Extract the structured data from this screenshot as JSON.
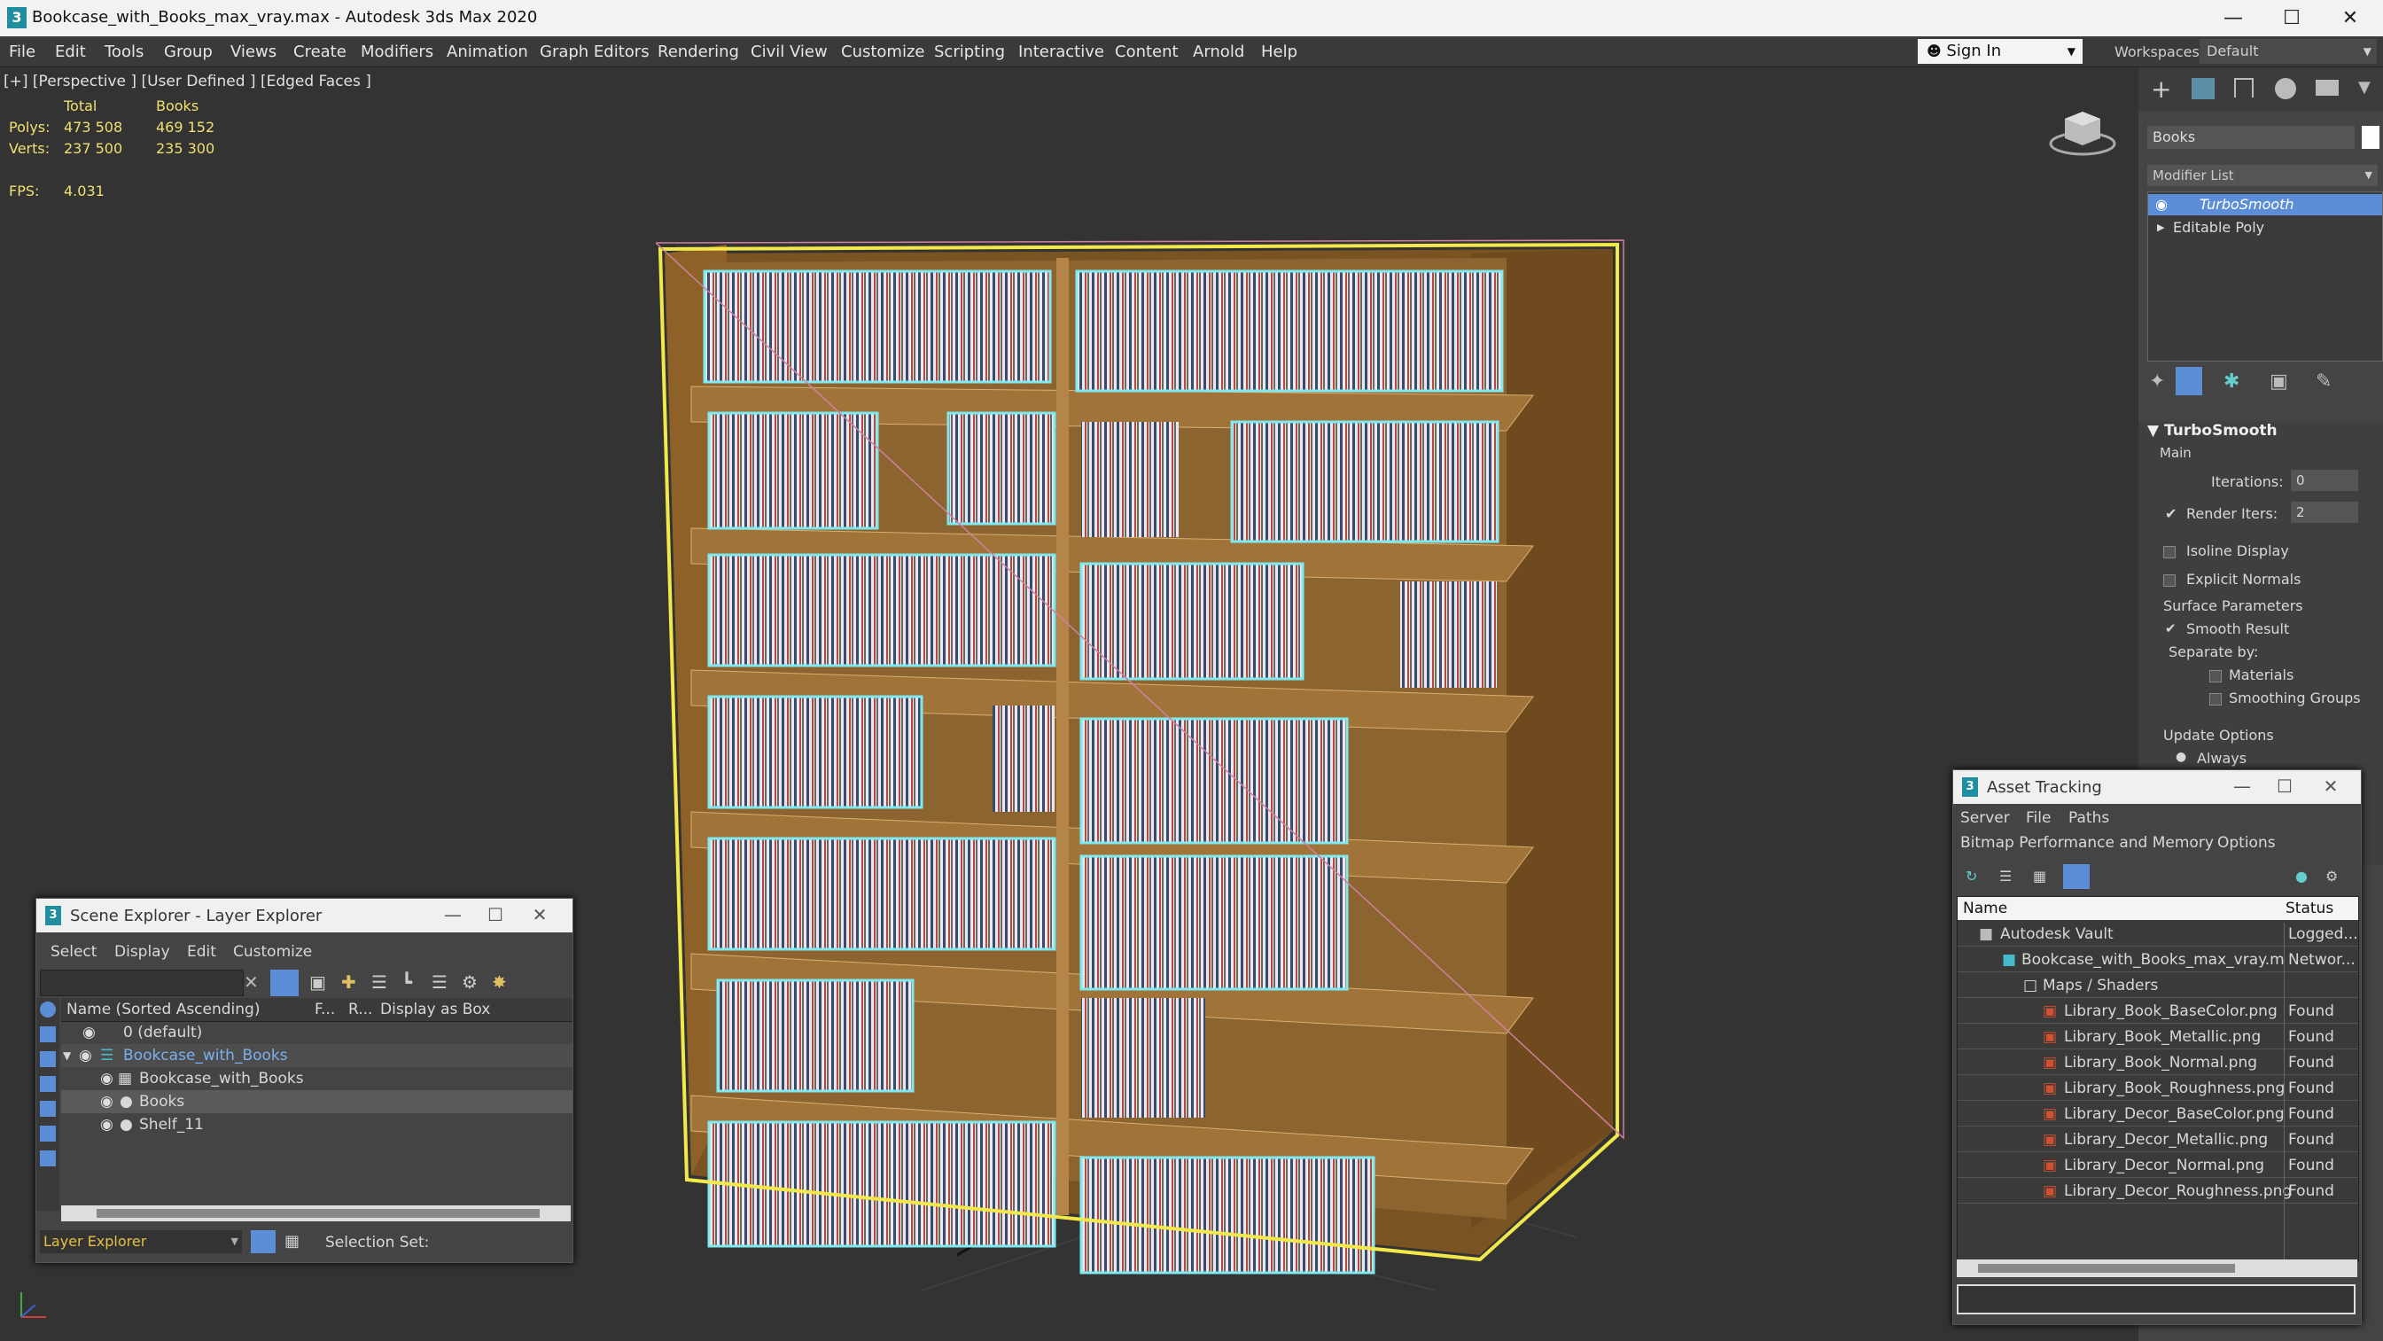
{
  "window": {
    "title": "Bookcase_with_Books_max_vray.max - Autodesk 3ds Max 2020",
    "app_icon": "3ds-max-icon"
  },
  "menu": [
    "File",
    "Edit",
    "Tools",
    "Group",
    "Views",
    "Create",
    "Modifiers",
    "Animation",
    "Graph Editors",
    "Rendering",
    "Civil View",
    "Customize",
    "Scripting",
    "Interactive",
    "Content",
    "Arnold",
    "Help"
  ],
  "signin": {
    "label": "Sign In"
  },
  "workspaces": {
    "label": "Workspaces:",
    "value": "Default"
  },
  "viewport": {
    "label": "[+] [Perspective ] [User Defined ] [Edged Faces ]",
    "stats": {
      "col_total": "Total",
      "col_books": "Books",
      "polys_label": "Polys:",
      "polys_total": "473 508",
      "polys_books": "469 152",
      "verts_label": "Verts:",
      "verts_total": "237 500",
      "verts_books": "235 300",
      "fps_label": "FPS:",
      "fps_value": "4.031"
    }
  },
  "command_panel": {
    "object_name": "Books",
    "object_color": "#ffffff",
    "modifier_list_label": "Modifier List",
    "stack": [
      "TurboSmooth",
      "Editable Poly"
    ],
    "rollout_title": "TurboSmooth",
    "main_label": "Main",
    "iterations_label": "Iterations:",
    "iterations_value": "0",
    "render_iters_label": "Render Iters:",
    "render_iters_value": "2",
    "isoline_label": "Isoline Display",
    "explicit_normals_label": "Explicit Normals",
    "surface_params_label": "Surface Parameters",
    "smooth_result_label": "Smooth Result",
    "separate_by_label": "Separate by:",
    "materials_label": "Materials",
    "smoothing_groups_label": "Smoothing Groups",
    "update_options_label": "Update Options",
    "always_label": "Always"
  },
  "scene_explorer": {
    "title": "Scene Explorer - Layer Explorer",
    "menu": [
      "Select",
      "Display",
      "Edit",
      "Customize"
    ],
    "columns": {
      "name": "Name (Sorted Ascending)",
      "f": "F...",
      "r": "R...",
      "display": "Display as Box"
    },
    "rows": [
      {
        "name": "0 (default)"
      },
      {
        "name": "Bookcase_with_Books"
      },
      {
        "name": "Bookcase_with_Books"
      },
      {
        "name": "Books"
      },
      {
        "name": "Shelf_11"
      }
    ],
    "footer_layer": "Layer Explorer",
    "footer_selset": "Selection Set:"
  },
  "asset_tracking": {
    "title": "Asset Tracking",
    "menu1": [
      "Server",
      "File",
      "Paths"
    ],
    "menu2": [
      "Bitmap Performance and Memory",
      "Options"
    ],
    "columns": {
      "name": "Name",
      "status": "Status"
    },
    "rows": [
      {
        "name": "Autodesk Vault",
        "status": "Logged...",
        "indent": 1
      },
      {
        "name": "Bookcase_with_Books_max_vray.max",
        "status": "Networ...",
        "indent": 2
      },
      {
        "name": "Maps / Shaders",
        "status": "",
        "indent": 3
      },
      {
        "name": "Library_Book_BaseColor.png",
        "status": "Found",
        "indent": 4
      },
      {
        "name": "Library_Book_Metallic.png",
        "status": "Found",
        "indent": 4
      },
      {
        "name": "Library_Book_Normal.png",
        "status": "Found",
        "indent": 4
      },
      {
        "name": "Library_Book_Roughness.png",
        "status": "Found",
        "indent": 4
      },
      {
        "name": "Library_Decor_BaseColor.png",
        "status": "Found",
        "indent": 4
      },
      {
        "name": "Library_Decor_Metallic.png",
        "status": "Found",
        "indent": 4
      },
      {
        "name": "Library_Decor_Normal.png",
        "status": "Found",
        "indent": 4
      },
      {
        "name": "Library_Decor_Roughness.png",
        "status": "Found",
        "indent": 4
      }
    ]
  },
  "colors": {
    "selection_yellow": "#f3e84a",
    "wire_cyan": "#7fe9f0",
    "wood": "#9a6a2c",
    "highlight_blue": "#5b8ed6"
  }
}
